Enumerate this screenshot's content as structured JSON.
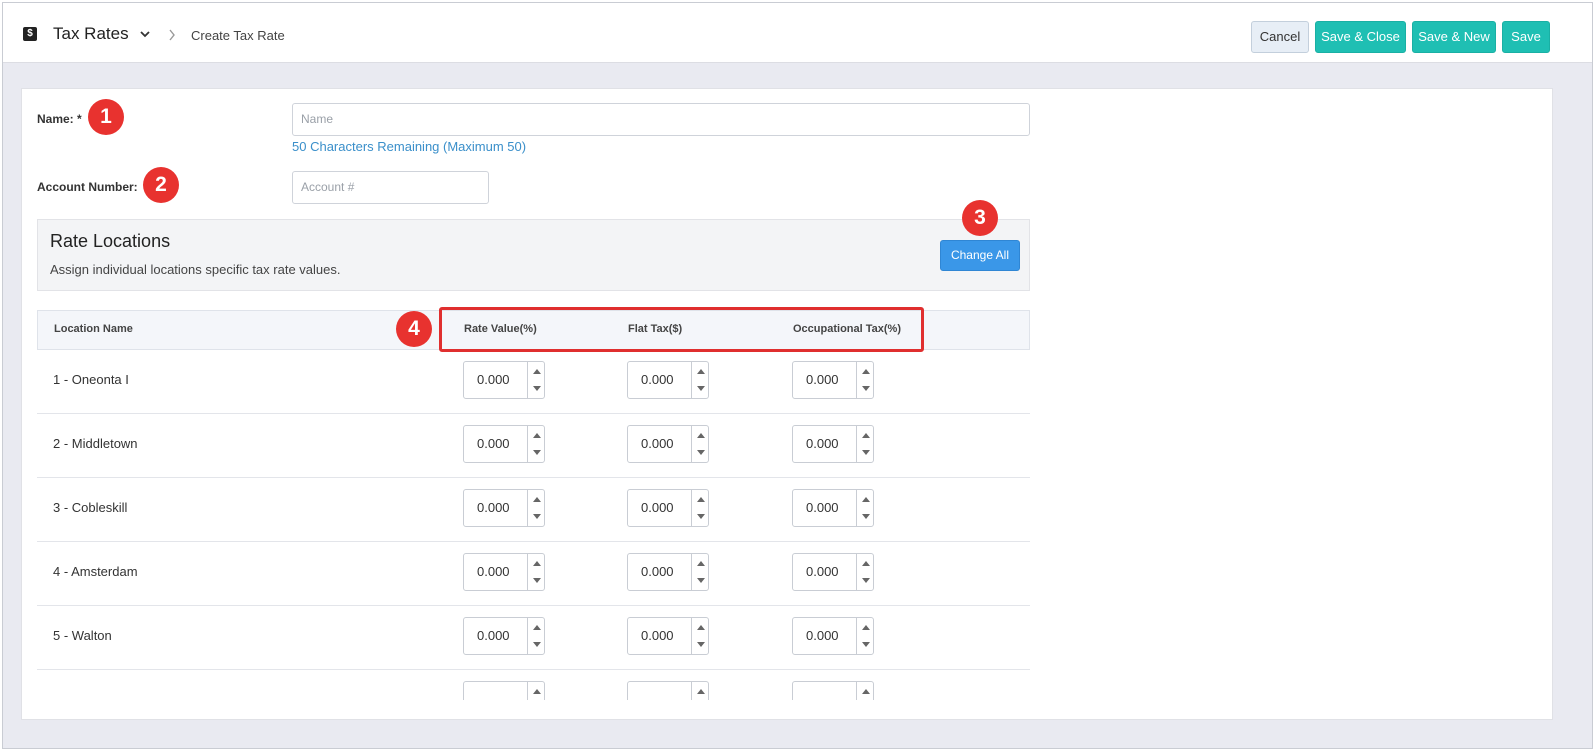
{
  "header": {
    "app_icon": "$",
    "title": "Tax Rates",
    "breadcrumb_current": "Create Tax Rate",
    "buttons": {
      "cancel": "Cancel",
      "save_close": "Save & Close",
      "save_new": "Save & New",
      "save": "Save"
    }
  },
  "form": {
    "name_label": "Name: *",
    "name_placeholder": "Name",
    "name_hint": "50 Characters Remaining (Maximum 50)",
    "account_label": "Account Number:",
    "account_placeholder": "Account #"
  },
  "rate_locations": {
    "title": "Rate Locations",
    "description": "Assign individual locations specific tax rate values.",
    "change_all_label": "Change All"
  },
  "table": {
    "columns": [
      "Location Name",
      "Rate Value(%)",
      "Flat Tax($)",
      "Occupational Tax(%)"
    ],
    "rows": [
      {
        "location": "1 - Oneonta I",
        "rate": "0.000",
        "flat": "0.000",
        "occupational": "0.000"
      },
      {
        "location": "2 - Middletown",
        "rate": "0.000",
        "flat": "0.000",
        "occupational": "0.000"
      },
      {
        "location": "3 - Cobleskill",
        "rate": "0.000",
        "flat": "0.000",
        "occupational": "0.000"
      },
      {
        "location": "4 - Amsterdam",
        "rate": "0.000",
        "flat": "0.000",
        "occupational": "0.000"
      },
      {
        "location": "5 - Walton",
        "rate": "0.000",
        "flat": "0.000",
        "occupational": "0.000"
      },
      {
        "location": "",
        "rate": "",
        "flat": "",
        "occupational": ""
      }
    ]
  },
  "annotations": {
    "badge_1": "1",
    "badge_2": "2",
    "badge_3": "3",
    "badge_4": "4",
    "badge_color": "#e8322f"
  }
}
